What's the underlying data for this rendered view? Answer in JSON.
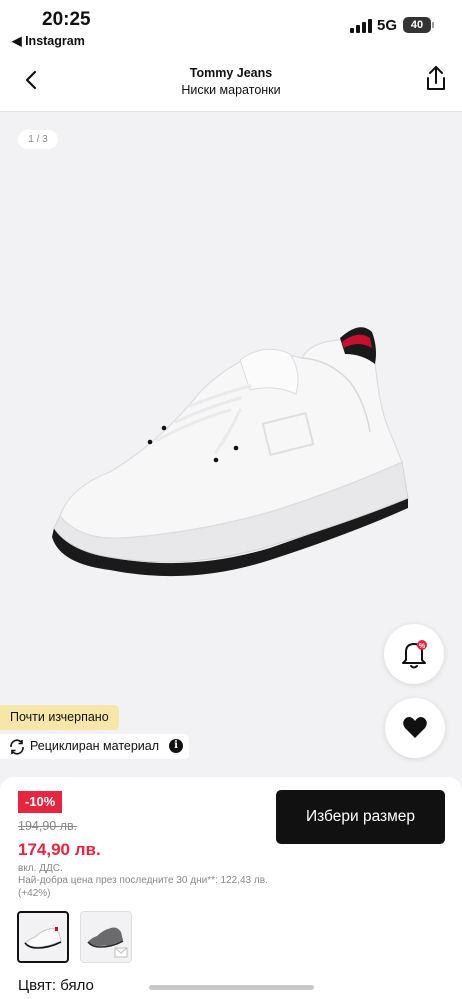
{
  "status_bar": {
    "time": "20:25",
    "back_app": "◀ Instagram",
    "network": "5G",
    "battery": "40"
  },
  "header": {
    "brand": "Tommy Jeans",
    "subtitle": "Ниски маратонки",
    "back_icon": "chevron-left-icon",
    "share_icon": "share-icon"
  },
  "gallery": {
    "counter": "1 / 3",
    "stock_badge": "Почти изчерпано",
    "eco_badge": "Рециклиран материал",
    "info_glyph": "i"
  },
  "product": {
    "discount": "-10%",
    "old_price": "194,90 лв.",
    "new_price": "174,90 лв.",
    "vat_note": "вкл. ДДС.",
    "best_price_note": "Най-добра цена през последните 30 дни**: 122,43 лв. (+42%)",
    "select_size": "Избери размер",
    "color_label": "Цвят: бяло"
  },
  "colors": {
    "accent_red": "#e8253e",
    "stock_badge_bg": "#f7e6a8",
    "button_bg": "#111111"
  }
}
